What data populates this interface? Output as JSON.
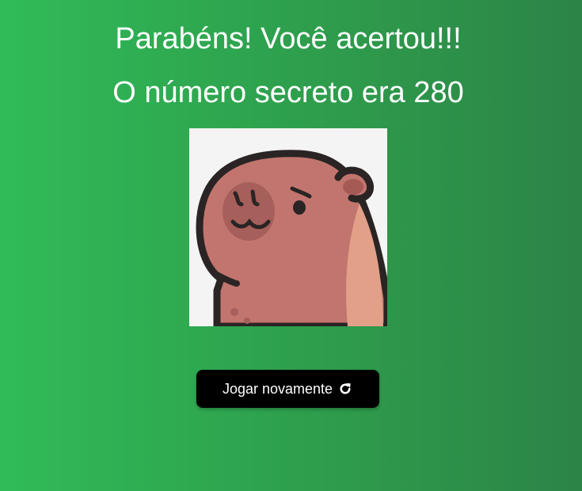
{
  "result": {
    "headline": "Parabéns! Você acertou!!!",
    "message": "O número secreto era 280"
  },
  "image": {
    "subject": "capybara-illustration",
    "background_color": "#f4f4f4",
    "body_color": "#c2756e"
  },
  "actions": {
    "play_again_label": "Jogar novamente",
    "play_again_icon": "refresh-icon"
  },
  "theme": {
    "gradient_start": "#30bb58",
    "gradient_end": "#2c8447",
    "button_background": "#000000",
    "text_color": "#ffffff"
  }
}
